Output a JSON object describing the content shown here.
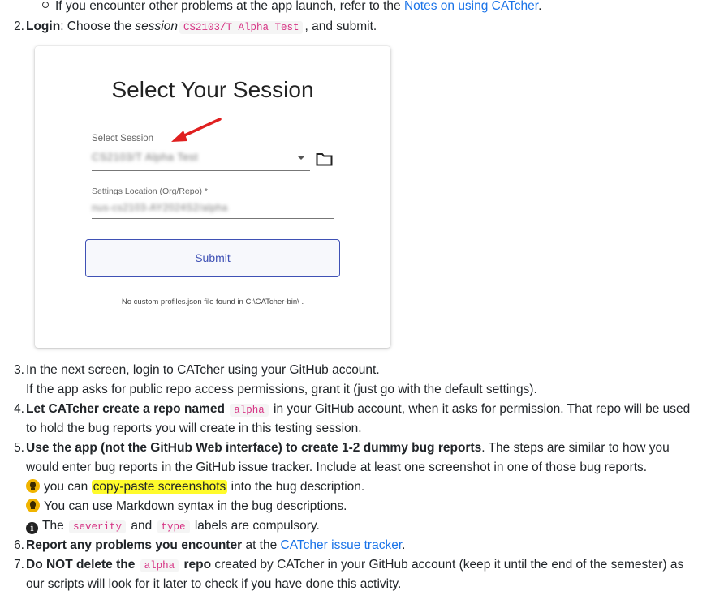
{
  "top_bullet": {
    "text": "If you encounter other problems at the app launch, refer to the ",
    "link": "Notes on using CATcher",
    "end": "."
  },
  "item2": {
    "num": "2.",
    "bold": "Login",
    "t1": ": Choose the ",
    "em": "session",
    "code": "CS2103/T Alpha Test",
    "t2": ", and submit."
  },
  "card": {
    "title": "Select Your Session",
    "select_label": "Select Session",
    "select_value": "CS2103/T Alpha Test",
    "settings_label": "Settings Location (Org/Repo) *",
    "settings_value": "nus-cs2103-AY2024S2/alpha",
    "submit_label": "Submit",
    "note": "No custom profiles.json file found in C:\\CATcher-bin\\ ."
  },
  "item3": {
    "num": "3.",
    "line1": "In the next screen, login to CATcher using your GitHub account.",
    "line2": "If the app asks for public repo access permissions, grant it (just go with the default settings)."
  },
  "item4": {
    "num": "4.",
    "bold": "Let CATcher create a repo named ",
    "code": "alpha",
    "t1": " in your GitHub account, when it asks for permission. That repo will be used",
    "line2": "to hold the bug reports you will create in this testing session."
  },
  "item5": {
    "num": "5.",
    "bold": "Use the app (not the GitHub Web interface) to create 1-2 dummy bug reports",
    "t1": ". The steps are similar to how you",
    "line2": "would enter bug reports in the GitHub issue tracker. Include at least one screenshot in one of those bug reports.",
    "tip1_pre": "you can ",
    "tip1_hl": "copy-paste screenshots",
    "tip1_post": " into the bug description.",
    "tip2": "You can use Markdown syntax in the bug descriptions.",
    "info_pre": "The ",
    "info_code1": "severity",
    "info_mid": " and ",
    "info_code2": "type",
    "info_post": " labels are compulsory."
  },
  "item6": {
    "num": "6.",
    "bold": "Report any problems you encounter",
    "t1": " at the ",
    "link": "CATcher issue tracker",
    "end": "."
  },
  "item7": {
    "num": "7.",
    "bold1": "Do NOT delete the ",
    "code": "alpha",
    "bold2": " repo",
    "t1": " created by CATcher in your GitHub account (keep it until the end of the semester) as",
    "line2": "our scripts will look for it later to check if you have done this activity."
  },
  "icons": {
    "bullet": "hollow-circle-bullet",
    "tip": "lightbulb-icon",
    "info": "info-circle-icon",
    "folder": "folder-icon",
    "arrow": "red-arrow-annotation"
  },
  "colors": {
    "link": "#1a73e8",
    "code": "#d63384",
    "highlight": "#fffb2b",
    "button": "#3f51b5",
    "arrow": "#e02020"
  }
}
